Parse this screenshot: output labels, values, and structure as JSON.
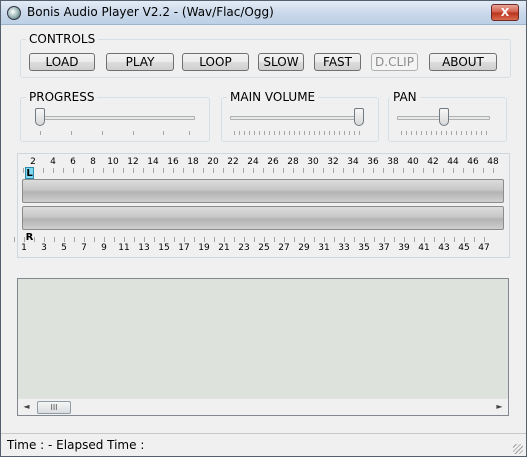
{
  "window": {
    "title": "Bonis Audio Player V2.2 - (Wav/Flac/Ogg)",
    "close_label": "X"
  },
  "controls": {
    "label": "CONTROLS",
    "buttons": {
      "load": "LOAD",
      "play": "PLAY",
      "loop": "LOOP",
      "slow": "SLOW",
      "fast": "FAST",
      "dclip": "D.CLIP",
      "about": "ABOUT"
    }
  },
  "progress": {
    "label": "PROGRESS",
    "value": 0
  },
  "volume": {
    "label": "MAIN VOLUME",
    "value": 1.0
  },
  "pan": {
    "label": "PAN",
    "value": 0.5
  },
  "meter": {
    "left_channel_label": "L",
    "right_channel_label": "R",
    "left_level": 0,
    "right_level": 0,
    "top_scale": [
      "2",
      "4",
      "6",
      "8",
      "10",
      "12",
      "14",
      "16",
      "18",
      "20",
      "22",
      "24",
      "26",
      "28",
      "30",
      "32",
      "34",
      "36",
      "38",
      "40",
      "42",
      "44",
      "46",
      "48"
    ],
    "bottom_scale": [
      "1",
      "3",
      "5",
      "7",
      "9",
      "11",
      "13",
      "15",
      "17",
      "19",
      "21",
      "23",
      "25",
      "27",
      "29",
      "31",
      "33",
      "35",
      "37",
      "39",
      "41",
      "43",
      "45",
      "47"
    ]
  },
  "playlist": {
    "scroll_left_label": "◄",
    "scroll_right_label": "►",
    "scroll_thumb_label": "III"
  },
  "status": {
    "text": "Time :  - Elapsed Time :"
  },
  "colors": {
    "left_channel_tag": "#7fd9f2",
    "listbox_bg": "#dde2dd"
  }
}
